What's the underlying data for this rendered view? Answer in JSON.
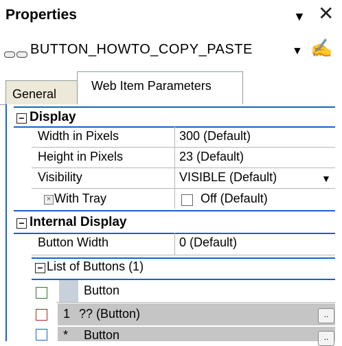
{
  "window": {
    "title": "Properties"
  },
  "object": {
    "name": "BUTTON_HOWTO_COPY_PASTE"
  },
  "tabs": [
    {
      "label": "General"
    },
    {
      "label": "Web Item Parameters"
    }
  ],
  "display": {
    "header": "Display",
    "rows": [
      {
        "label": "Width in Pixels",
        "value": "300 (Default)"
      },
      {
        "label": "Height in Pixels",
        "value": "23 (Default)"
      },
      {
        "label": "Visibility",
        "value": "VISIBLE (Default)"
      },
      {
        "label": "With Tray",
        "value": "Off (Default)"
      }
    ]
  },
  "internal": {
    "header": "Internal Display",
    "button_width_label": "Button Width",
    "button_width_value": "0 (Default)",
    "list_label": "List of Buttons (1)",
    "col_header": "Button",
    "item_index": "1",
    "item_label": "?? (Button)",
    "new_marker": "*",
    "new_label": "Button"
  },
  "ellipsis": ".."
}
